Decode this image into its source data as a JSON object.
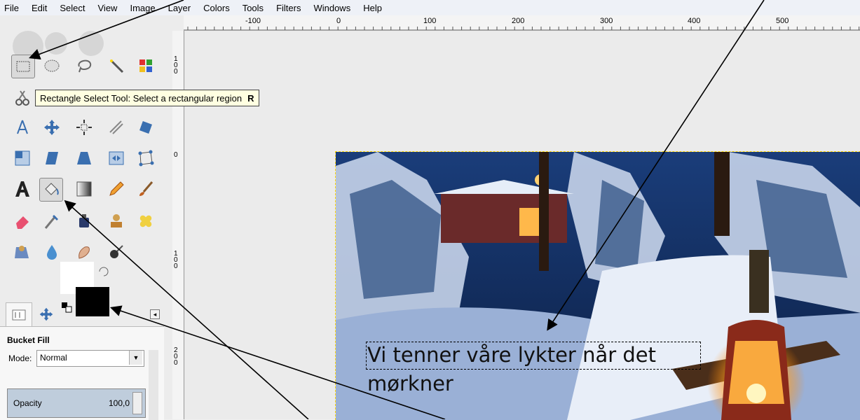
{
  "menubar": {
    "items": [
      {
        "label": "File"
      },
      {
        "label": "Edit"
      },
      {
        "label": "Select"
      },
      {
        "label": "View"
      },
      {
        "label": "Image"
      },
      {
        "label": "Layer"
      },
      {
        "label": "Colors"
      },
      {
        "label": "Tools"
      },
      {
        "label": "Filters"
      },
      {
        "label": "Windows"
      },
      {
        "label": "Help"
      }
    ]
  },
  "rulers": {
    "horizontal_ticks": [
      "-100",
      "0",
      "100",
      "200",
      "300",
      "400",
      "500"
    ],
    "vertical_ticks": [
      "100",
      "0",
      "100",
      "200"
    ]
  },
  "tooltip": {
    "text": "Rectangle Select Tool: Select a rectangular region",
    "shortcut": "R"
  },
  "canvas_text": {
    "line1": "Vi tenner våre lykter når det",
    "line2": "mørkner"
  },
  "tool_options": {
    "title": "Bucket Fill",
    "mode_label": "Mode:",
    "mode_value": "Normal",
    "opacity_label": "Opacity",
    "opacity_value": "100,0"
  },
  "colors": {
    "foreground": "#000000",
    "background": "#ffffff",
    "selection": "#ffd800",
    "tooltip_bg": "#ffffe1"
  },
  "icons": [
    "rect-select",
    "ellipse-select",
    "free-select",
    "fuzzy-select",
    "color-select",
    "scissors",
    "move",
    "align",
    "crop",
    "rotate",
    "scale",
    "shear",
    "perspective",
    "flip",
    "cage",
    "text",
    "bucket-fill",
    "blend",
    "pencil",
    "paintbrush",
    "eraser",
    "airbrush",
    "ink",
    "clone",
    "heal",
    "perspective-clone",
    "blur",
    "smudge",
    "dodge-burn"
  ]
}
